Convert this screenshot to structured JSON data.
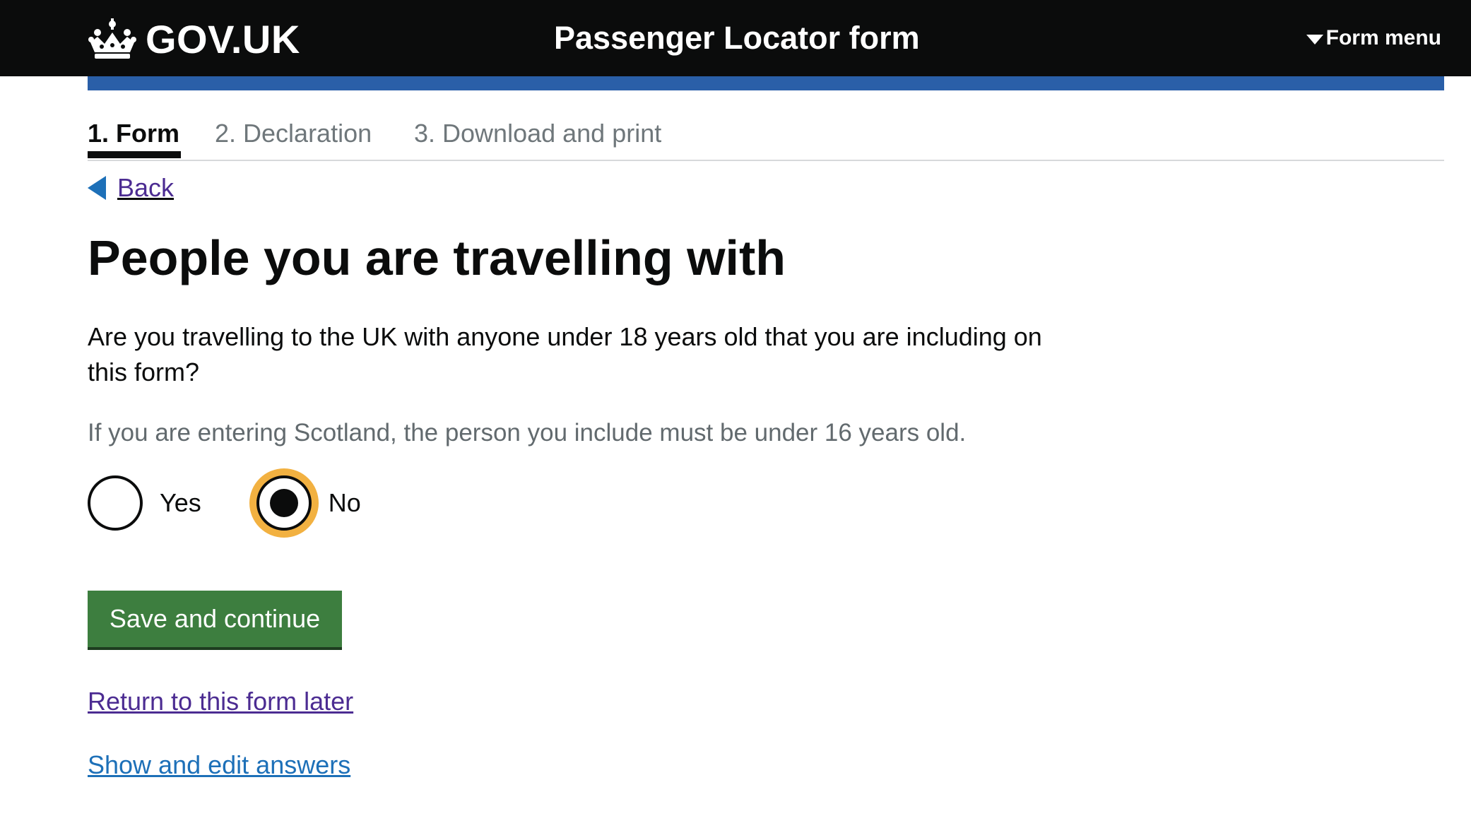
{
  "header": {
    "logo_text": "GOV.UK",
    "service_name": "Passenger Locator form",
    "form_menu_label": "Form menu"
  },
  "steps": [
    {
      "label": "1. Form",
      "active": true
    },
    {
      "label": "2. Declaration",
      "active": false
    },
    {
      "label": "3. Download and print",
      "active": false
    }
  ],
  "back_label": "Back",
  "page_title": "People you are travelling with",
  "question": "Are you travelling to the UK with anyone under 18 years old that you are including on this form?",
  "hint": "If you are entering Scotland, the person you include must be under 16 years old.",
  "radios": [
    {
      "label": "Yes",
      "checked": false
    },
    {
      "label": "No",
      "checked": true
    }
  ],
  "save_button_label": "Save and continue",
  "links": {
    "return_later": "Return to this form later",
    "show_edit": "Show and edit answers"
  },
  "colors": {
    "header_bg": "#0b0c0c",
    "accent_bar": "#2a5fa8",
    "button_green": "#3d7e3f",
    "focus_yellow": "#f2b141",
    "link_visited": "#4c2c92",
    "link_blue": "#1d70b8"
  },
  "icons": {
    "logo": "crown-icon",
    "menu": "triangle-down-icon",
    "back": "chevron-left-icon"
  }
}
